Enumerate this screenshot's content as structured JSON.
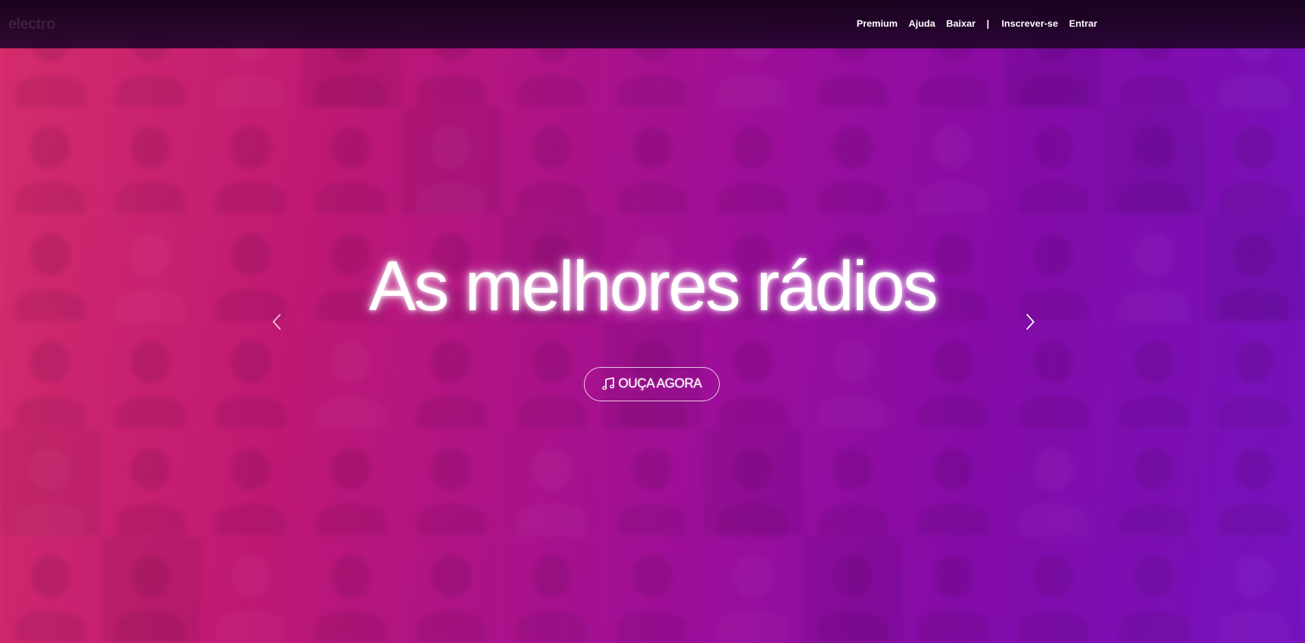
{
  "nav": {
    "premium": "Premium",
    "help": "Ajuda",
    "download": "Baixar",
    "separator": "|",
    "signup": "Inscrever-se",
    "login": "Entrar"
  },
  "hero": {
    "title": "As melhores rádios",
    "cta_label": "OUÇA AGORA",
    "cta_icon": "music-note-icon",
    "prev_icon": "chevron-left-icon",
    "next_icon": "chevron-right-icon"
  },
  "colors": {
    "gradient_start": "#e0306f",
    "gradient_mid": "#a510a0",
    "gradient_end": "#7a14c8",
    "topbar": "#1a0520",
    "text": "#ffffff"
  }
}
